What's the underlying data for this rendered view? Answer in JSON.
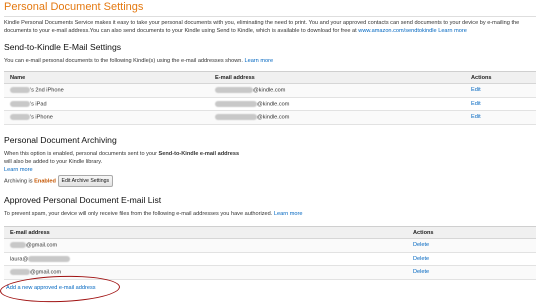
{
  "title": "Personal Document Settings",
  "intro": {
    "text": "Kindle Personal Documents Service makes it easy to take your personal documents with you, eliminating the need to print. You and your approved contacts can send documents to your device by e-mailing the documents to your e-mail address.You can also send documents to your Kindle using Send to Kindle, which is available to download for free at ",
    "link": "www.amazon.com/sendtokindle",
    "more": "Learn more"
  },
  "s2k": {
    "heading": "Send-to-Kindle E-Mail Settings",
    "desc": "You can e-mail personal documents to the following Kindle(s) using the e-mail addresses shown.",
    "more": "Learn more",
    "columns": [
      "Name",
      "E-mail address",
      "Actions"
    ],
    "rows": [
      {
        "name": "'s 2nd iPhone",
        "email": "@kindle.com",
        "action": "Edit"
      },
      {
        "name": "'s iPad",
        "email": "@kindle.com",
        "action": "Edit"
      },
      {
        "name": "'s iPhone",
        "email": "@kindle.com",
        "action": "Edit"
      }
    ]
  },
  "archiving": {
    "heading": "Personal Document Archiving",
    "line1": "When this option is enabled, personal documents sent to your ",
    "line1_bold": "Send-to-Kindle e-mail address",
    "line2": "will also be added to your Kindle library.",
    "more": "Learn more",
    "status_label": "Archiving is",
    "status_value": "Enabled",
    "button": "Edit Archive Settings"
  },
  "approved": {
    "heading": "Approved Personal Document E-mail List",
    "desc": "To prevent spam, your device will only receive files from the following e-mail addresses you have authorized.",
    "more": "Learn more",
    "columns": [
      "E-mail address",
      "Actions"
    ],
    "rows": [
      {
        "email": "@gmail.com",
        "action": "Delete"
      },
      {
        "email": "laura@",
        "action": "Delete"
      },
      {
        "email": "@gmail.com",
        "action": "Delete"
      }
    ],
    "add_link": "Add a new approved e-mail address"
  },
  "colors": {
    "title": "#e47911",
    "link": "#0066c0",
    "enabled": "#c45500",
    "annotation": "#a01212"
  }
}
